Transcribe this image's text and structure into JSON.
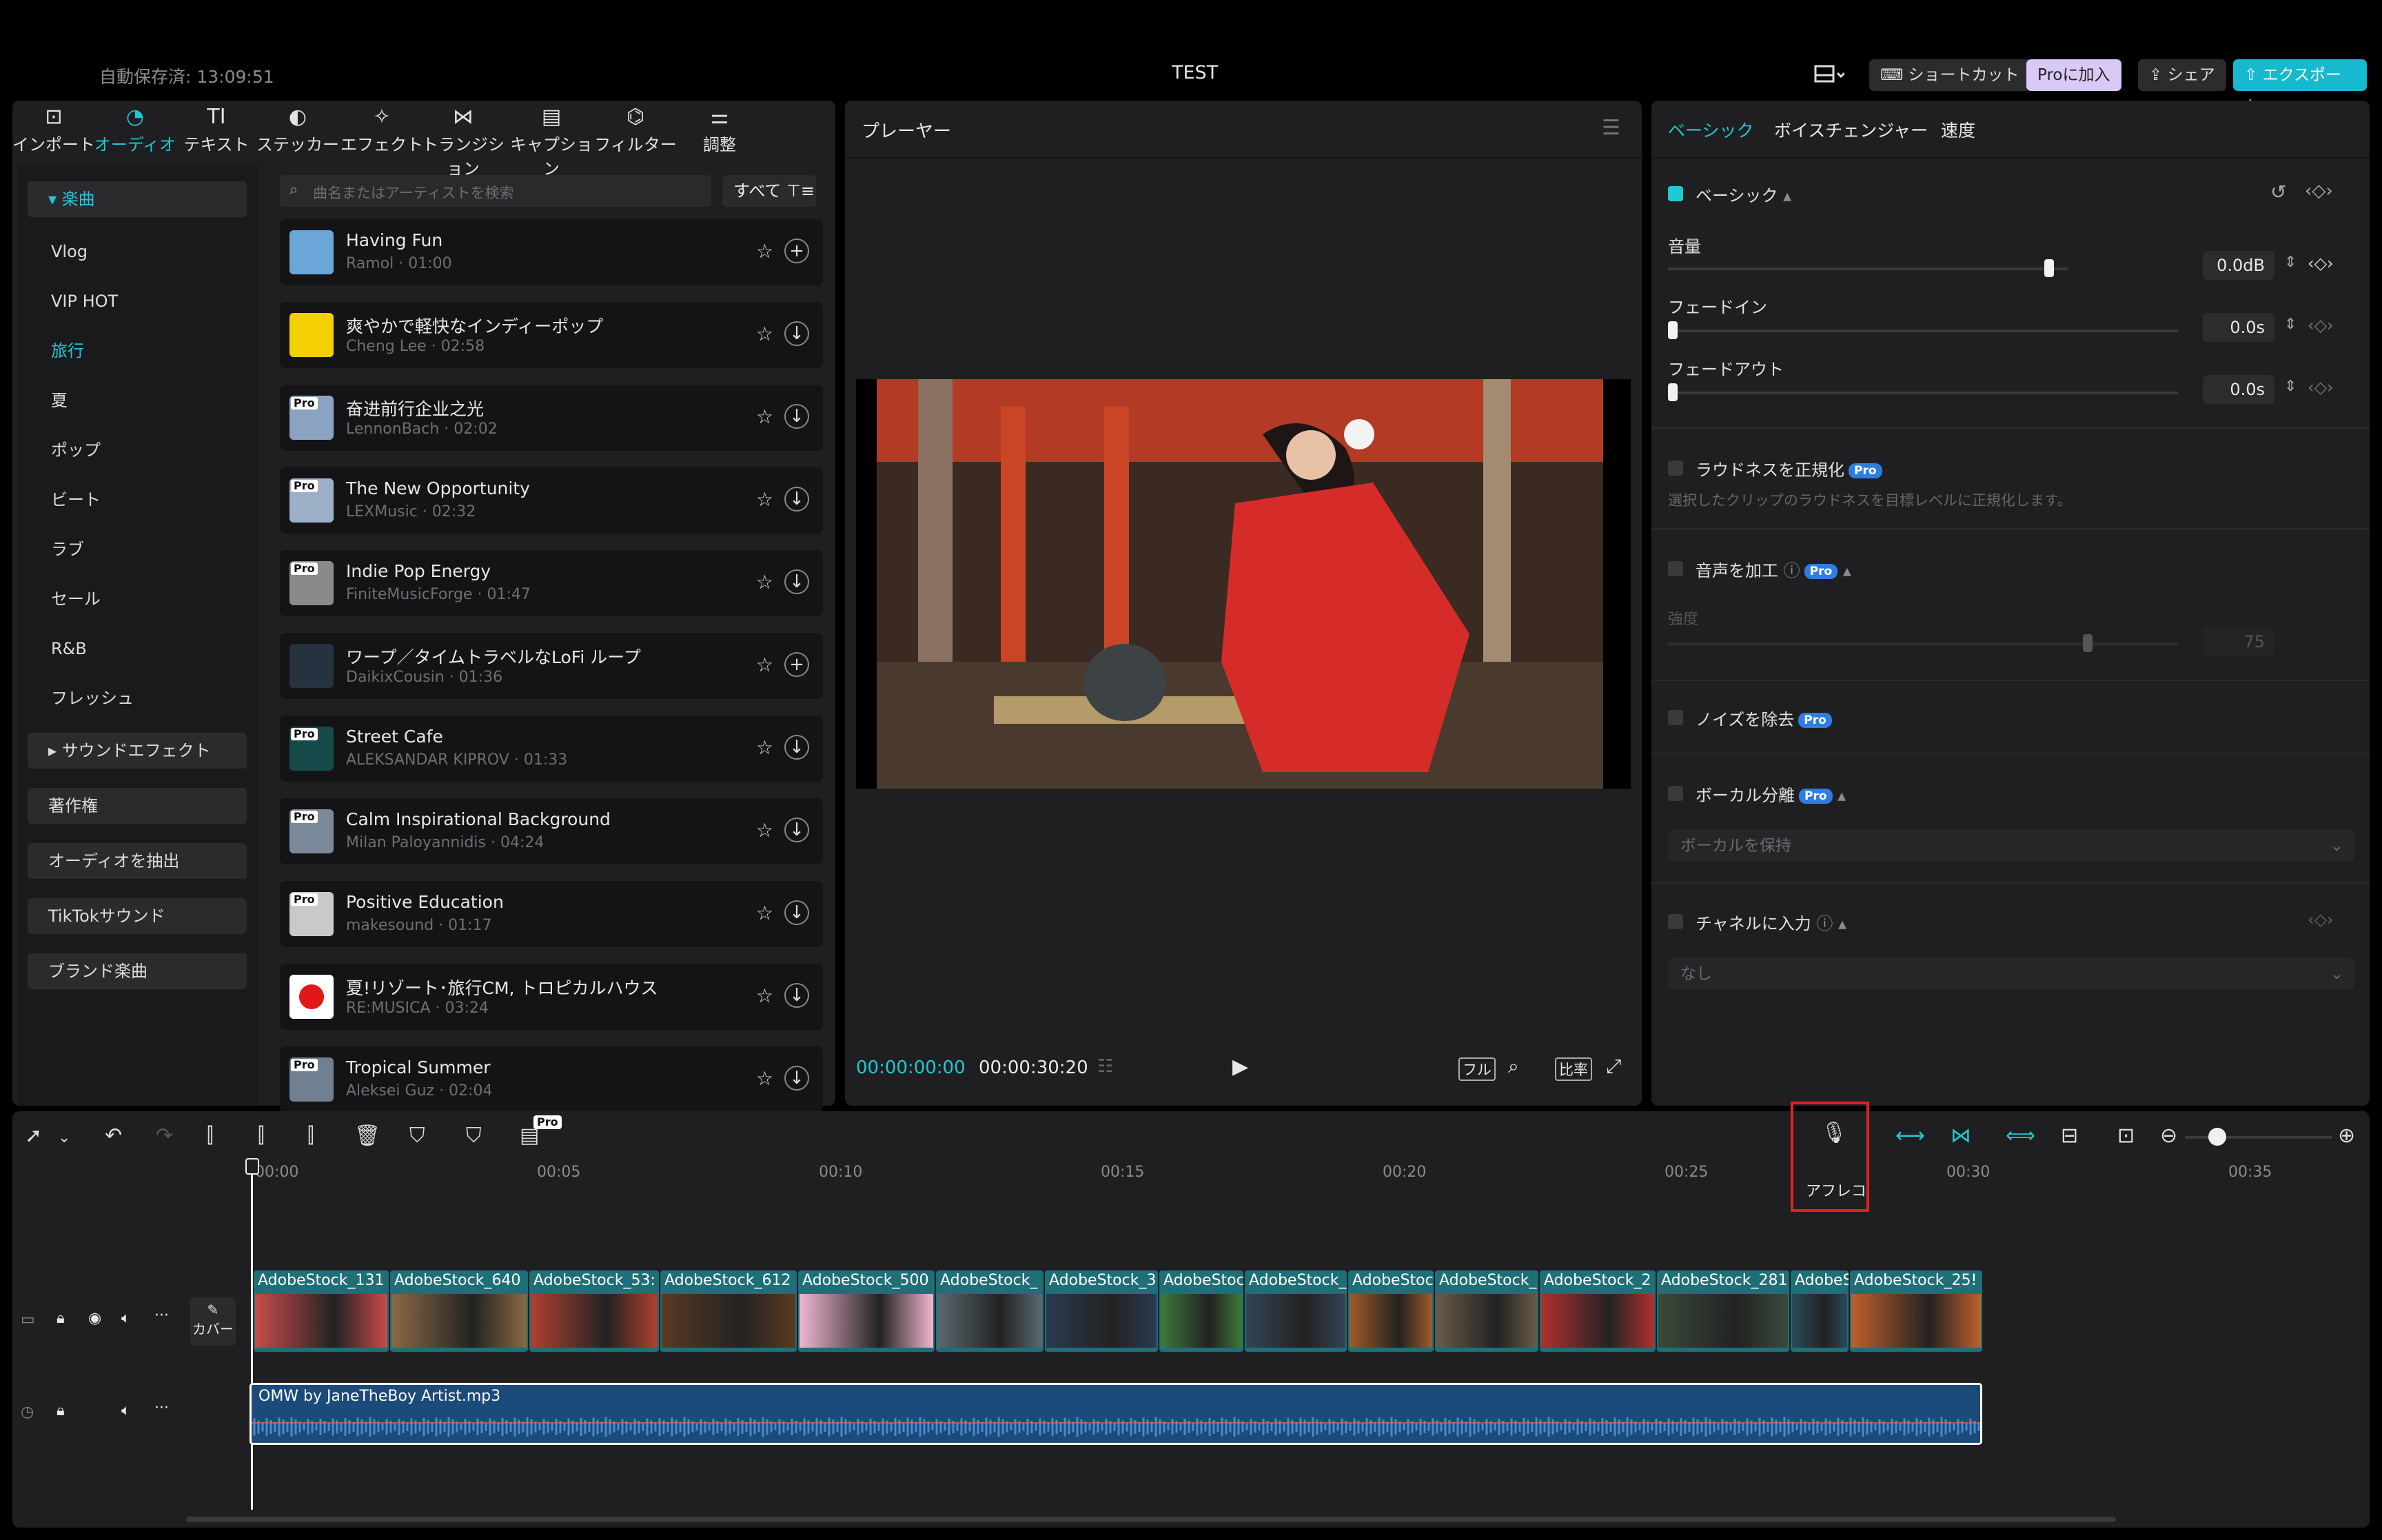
{
  "header": {
    "autosave": "自動保存済: 13:09:51",
    "title": "TEST",
    "shortcut": "ショートカット",
    "pro_join": "Proに加入",
    "share": "シェア",
    "export": "エクスポート"
  },
  "tool_tabs": [
    {
      "label": "インポート",
      "icon": "import-icon"
    },
    {
      "label": "オーディオ",
      "icon": "audio-icon"
    },
    {
      "label": "テキスト",
      "icon": "text-icon"
    },
    {
      "label": "ステッカー",
      "icon": "sticker-icon"
    },
    {
      "label": "エフェクト",
      "icon": "effect-icon"
    },
    {
      "label": "トランジション",
      "icon": "transition-icon"
    },
    {
      "label": "キャプション",
      "icon": "caption-icon"
    },
    {
      "label": "フィルター",
      "icon": "filter-icon"
    },
    {
      "label": "調整",
      "icon": "adjust-icon"
    }
  ],
  "categories": {
    "music": "楽曲",
    "items": [
      "Vlog",
      "VIP HOT",
      "旅行",
      "夏",
      "ポップ",
      "ビート",
      "ラブ",
      "セール",
      "R&B",
      "フレッシュ"
    ],
    "sound_effects": "サウンドエフェクト",
    "copyright": "著作権",
    "extract": "オーディオを抽出",
    "tiktok": "TikTokサウンド",
    "brand": "ブランド楽曲"
  },
  "search": {
    "placeholder": "曲名またはアーティストを検索",
    "filter": "すべて"
  },
  "songs": [
    {
      "title": "Having Fun",
      "sub": "Ramol · 01:00",
      "pro": false,
      "action": "+"
    },
    {
      "title": "爽やかで軽快なインディーポップ",
      "sub": "Cheng Lee · 02:58",
      "pro": false,
      "action": "↓"
    },
    {
      "title": "奋进前行企业之光",
      "sub": "LennonBach · 02:02",
      "pro": true,
      "action": "↓"
    },
    {
      "title": "The New Opportunity",
      "sub": "LEXMusic · 02:32",
      "pro": true,
      "action": "↓"
    },
    {
      "title": "Indie Pop Energy",
      "sub": "FiniteMusicForge · 01:47",
      "pro": true,
      "action": "↓"
    },
    {
      "title": "ワープ／タイムトラベルなLoFi ループ",
      "sub": "DaikixCousin · 01:36",
      "pro": false,
      "action": "+"
    },
    {
      "title": "Street Cafe",
      "sub": "ALEKSANDAR KIPROV · 01:33",
      "pro": true,
      "action": "↓"
    },
    {
      "title": "Calm Inspirational Background",
      "sub": "Milan Paloyannidis · 04:24",
      "pro": true,
      "action": "↓"
    },
    {
      "title": "Positive Education",
      "sub": "makesound · 01:17",
      "pro": true,
      "action": "↓"
    },
    {
      "title": "夏!リゾート･旅行CM, トロピカルハウス",
      "sub": "RE:MUSICA · 03:24",
      "pro": false,
      "action": "↓"
    },
    {
      "title": "Tropical Summer",
      "sub": "Aleksei Guz · 02:04",
      "pro": true,
      "action": "↓"
    }
  ],
  "player": {
    "title": "プレーヤー",
    "current_time": "00:00:00:00",
    "total_time": "00:00:30:20",
    "full": "フル",
    "ratio": "比率"
  },
  "inspector": {
    "tabs": [
      "ベーシック",
      "ボイスチェンジャー",
      "速度"
    ],
    "basic": "ベーシック",
    "volume_label": "音量",
    "volume_value": "0.0dB",
    "volume_level": 0.9,
    "fadein_label": "フェードイン",
    "fadein_value": "0.0s",
    "fadeout_label": "フェードアウト",
    "fadeout_value": "0.0s",
    "loudness": "ラウドネスを正規化",
    "loudness_desc": "選択したクリップのラウドネスを目標レベルに正規化します。",
    "voice_process": "音声を加工",
    "strength": "強度",
    "strength_value": "75",
    "noise": "ノイズを除去",
    "vocal": "ボーカル分離",
    "vocal_option": "ボーカルを保持",
    "channel": "チャネルに入力",
    "channel_option": "なし",
    "pro": "Pro"
  },
  "timeline": {
    "ruler": [
      "00:00",
      "00:05",
      "00:10",
      "00:15",
      "00:20",
      "00:25",
      "00:30",
      "00:35"
    ],
    "tooltip": "アフレコ",
    "cover": "カバー",
    "pro_tag": "Pro",
    "clips": [
      "AdobeStock_131",
      "AdobeStock_640",
      "AdobeStock_53:",
      "AdobeStock_612",
      "AdobeStock_500",
      "AdobeStock_",
      "AdobeStock_3",
      "AdobeStoc",
      "AdobeStock_",
      "AdobeStoc",
      "AdobeStock_",
      "AdobeStock_2",
      "AdobeStock_281",
      "AdobeS",
      "AdobeStock_25!"
    ],
    "audio_clip": "OMW by JaneTheBoy Artist.mp3"
  },
  "colors": {
    "accent": "#22c7d4",
    "panel": "#1f1f21",
    "video_clip": "#1e6f78",
    "audio_clip": "#1b4b7a",
    "highlight_box": "#e0241b"
  }
}
